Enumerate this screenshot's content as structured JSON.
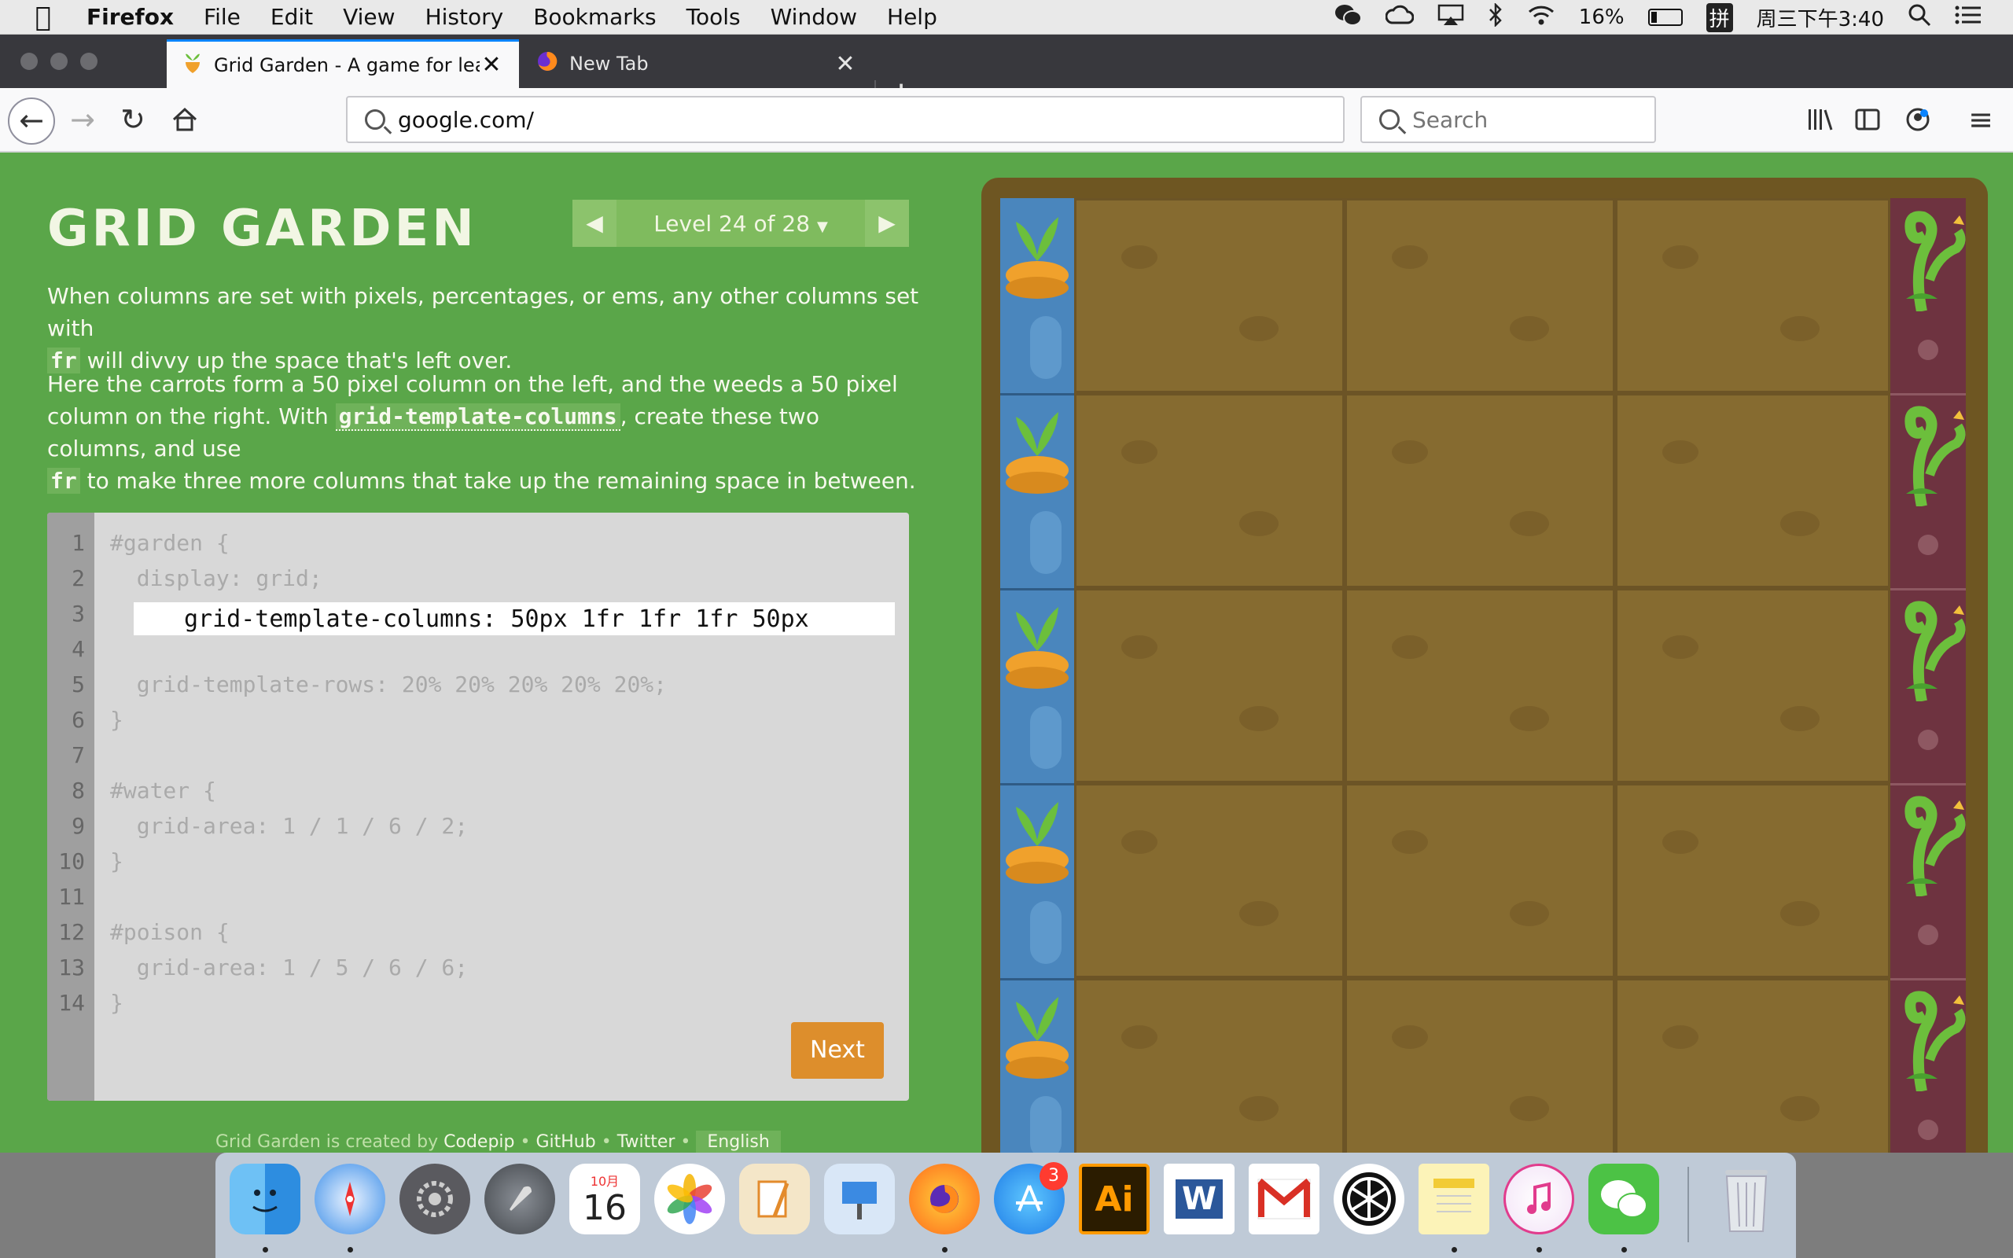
{
  "menubar": {
    "app_name": "Firefox",
    "items": [
      "File",
      "Edit",
      "View",
      "History",
      "Bookmarks",
      "Tools",
      "Window",
      "Help"
    ],
    "battery": "16%",
    "input_method": "拼",
    "clock": "周三下午3:40"
  },
  "tabs": [
    {
      "title": "Grid Garden - A game for learni",
      "active": true
    },
    {
      "title": "New Tab",
      "active": false
    }
  ],
  "toolbar": {
    "url": "google.com/",
    "search_placeholder": "Search"
  },
  "game": {
    "title": "GRID GARDEN",
    "level_label": "Level 24 of 28",
    "instructions": {
      "p1_a": "When columns are set with pixels, percentages, or ems, any other columns set with",
      "p1_code": "fr",
      "p1_b": " will divvy up the space that's left over.",
      "p2_a": "Here the carrots form a 50 pixel column on the left, and the weeds a 50 pixel column on the right. With ",
      "p2_code1": "grid-template-columns",
      "p2_b": ", create these two columns, and use",
      "p2_code2": "fr",
      "p2_c": " to make three more columns that take up the remaining space in between."
    },
    "editor": {
      "line_numbers": [
        "1",
        "2",
        "3",
        "4",
        "5",
        "6",
        "7",
        "8",
        "9",
        "10",
        "11",
        "12",
        "13",
        "14"
      ],
      "lines": {
        "l1": "#garden {",
        "l2": "  display: grid;",
        "l5": "  grid-template-rows: 20% 20% 20% 20% 20%;",
        "l6": "}",
        "l8": "#water {",
        "l9": "  grid-area: 1 / 1 / 6 / 2;",
        "l10": "}",
        "l12": "#poison {",
        "l13": "  grid-area: 1 / 5 / 6 / 6;",
        "l14": "}"
      },
      "input_value": "grid-template-columns: 50px 1fr 1fr 1fr 50px"
    },
    "next_label": "Next",
    "footer": {
      "prefix": "Grid Garden is created by ",
      "codepip": "Codepip",
      "sep1": " • ",
      "github": "GitHub",
      "sep2": " • ",
      "twitter": "Twitter",
      "sep3": " • ",
      "language": "English"
    }
  },
  "dock": {
    "apps": [
      "finder",
      "safari",
      "system-preferences",
      "launchpad",
      "calendar",
      "photos",
      "pages",
      "keynote",
      "firefox",
      "app-store",
      "illustrator",
      "word",
      "gmail",
      "capture",
      "notes",
      "itunes",
      "wechat",
      "trash"
    ],
    "calendar_month": "10月",
    "calendar_day": "16",
    "appstore_badge": "3",
    "illustrator_label": "Ai",
    "word_label": "W"
  },
  "colors": {
    "page_bg": "#5aa649",
    "soil": "#866b30",
    "water": "#4a86bd",
    "poison": "#6e3340",
    "next_button": "#dd8e2c"
  }
}
